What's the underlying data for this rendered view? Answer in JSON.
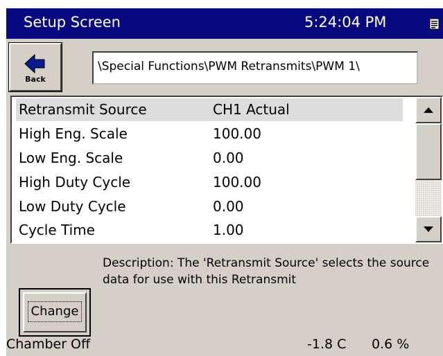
{
  "titlebar": {
    "title": "Setup Screen",
    "time": "5:24:04 PM",
    "icon": "keyboard-icon"
  },
  "back_button": {
    "label": "Back",
    "icon": "arrow-left-icon"
  },
  "path": {
    "value": "\\Special Functions\\PWM Retransmits\\PWM 1\\"
  },
  "settings_list": {
    "selected_index": 0,
    "rows": [
      {
        "name": "Retransmit Source",
        "value": "CH1 Actual"
      },
      {
        "name": "High Eng. Scale",
        "value": "100.00"
      },
      {
        "name": "Low Eng. Scale",
        "value": "0.00"
      },
      {
        "name": "High Duty Cycle",
        "value": "100.00"
      },
      {
        "name": "Low Duty Cycle",
        "value": "0.00"
      },
      {
        "name": "Cycle Time",
        "value": "1.00"
      }
    ]
  },
  "description": {
    "text": "Description:  The 'Retransmit Source' selects the source data for use with this Retransmit"
  },
  "change_button": {
    "label": "Change"
  },
  "status": {
    "chamber": "Chamber Off",
    "temperature": "-1.8 C",
    "humidity": "0.6 %"
  },
  "colors": {
    "titlebar": "#0a0a80",
    "panel": "#d4d0c8",
    "selected_row": "#dcdcdc"
  }
}
